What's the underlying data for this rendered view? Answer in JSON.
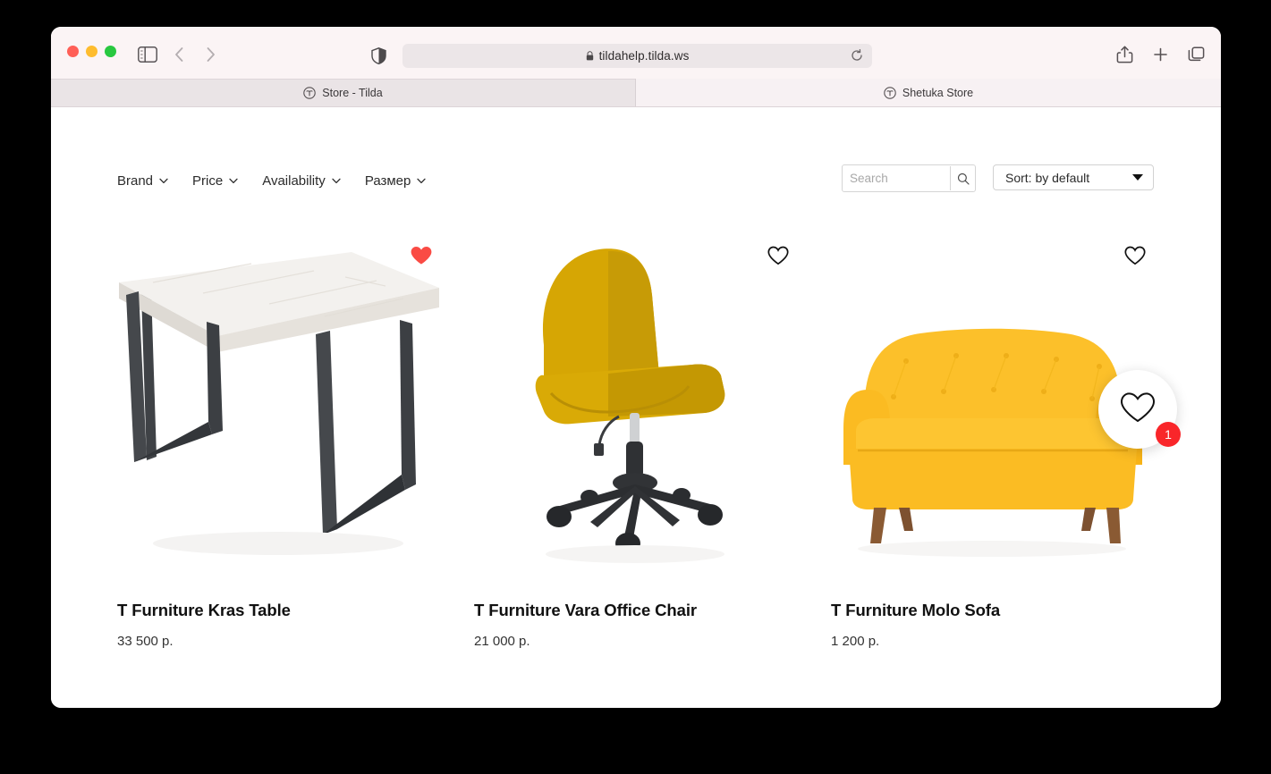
{
  "browser": {
    "traffic_lights": [
      "close",
      "minimize",
      "zoom"
    ],
    "url": "tildahelp.tilda.ws",
    "lock_icon": "lock-icon",
    "reload_icon": "reload-icon",
    "sidebar_icon": "sidebar-toggle-icon",
    "back_icon": "chevron-left-icon",
    "forward_icon": "chevron-right-icon",
    "shield_icon": "privacy-shield-icon",
    "share_icon": "share-icon",
    "newtab_icon": "plus-icon",
    "tabs_overview_icon": "tab-overview-icon",
    "tabs": [
      {
        "title": "Store - Tilda",
        "favicon": "tilda-favicon",
        "active": false
      },
      {
        "title": "Shetuka Store",
        "favicon": "tilda-favicon",
        "active": true
      }
    ]
  },
  "store": {
    "filters": [
      {
        "label": "Brand",
        "icon": "chevron-down-icon"
      },
      {
        "label": "Price",
        "icon": "chevron-down-icon"
      },
      {
        "label": "Availability",
        "icon": "chevron-down-icon"
      },
      {
        "label": "Размер",
        "icon": "chevron-down-icon"
      }
    ],
    "search": {
      "value": "",
      "placeholder": "Search",
      "icon": "search-icon"
    },
    "sort": {
      "label": "Sort: by default",
      "icon": "triangle-down-icon"
    },
    "products": [
      {
        "title": "T Furniture Kras Table",
        "price": "33 500 p.",
        "favorited": true,
        "heart_icon": "heart-filled-icon",
        "image": "white-wood-table-black-legs"
      },
      {
        "title": "T Furniture Vara Office Chair",
        "price": "21 000 p.",
        "favorited": false,
        "heart_icon": "heart-outline-icon",
        "image": "mustard-yellow-office-chair"
      },
      {
        "title": "T Furniture Molo Sofa",
        "price": "1 200 p.",
        "favorited": false,
        "heart_icon": "heart-outline-icon",
        "image": "yellow-tufted-sofa"
      }
    ],
    "favorites_widget": {
      "icon": "heart-outline-icon",
      "count": "1"
    },
    "colors": {
      "heart_red": "#fa4b44",
      "badge_red": "#f9262a",
      "chair_yellow": "#d8a800",
      "sofa_yellow": "#fcc02a",
      "text": "#111111"
    }
  }
}
